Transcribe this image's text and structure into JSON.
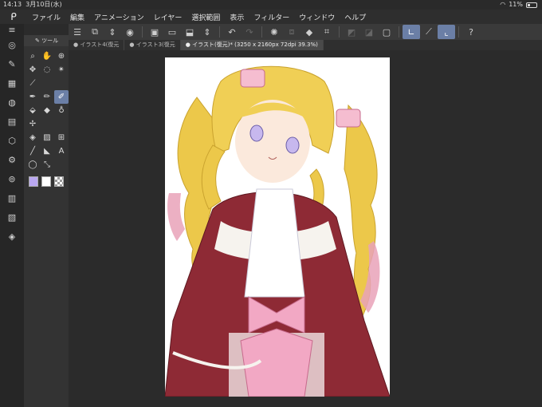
{
  "status": {
    "time": "14:13",
    "date": "3月10日(水)",
    "battery": "11%"
  },
  "menu": [
    "ファイル",
    "編集",
    "アニメーション",
    "レイヤー",
    "選択範囲",
    "表示",
    "フィルター",
    "ウィンドウ",
    "ヘルプ"
  ],
  "toolpanel": {
    "title": "ツール"
  },
  "tabs": [
    "イラスト4(復元",
    "イラスト3(復元",
    "イラスト(復元)* (3250 x 2160px 72dpi 39.3%)"
  ],
  "colors": {
    "main": "#b9a7f0",
    "sub": "#ffffff"
  }
}
